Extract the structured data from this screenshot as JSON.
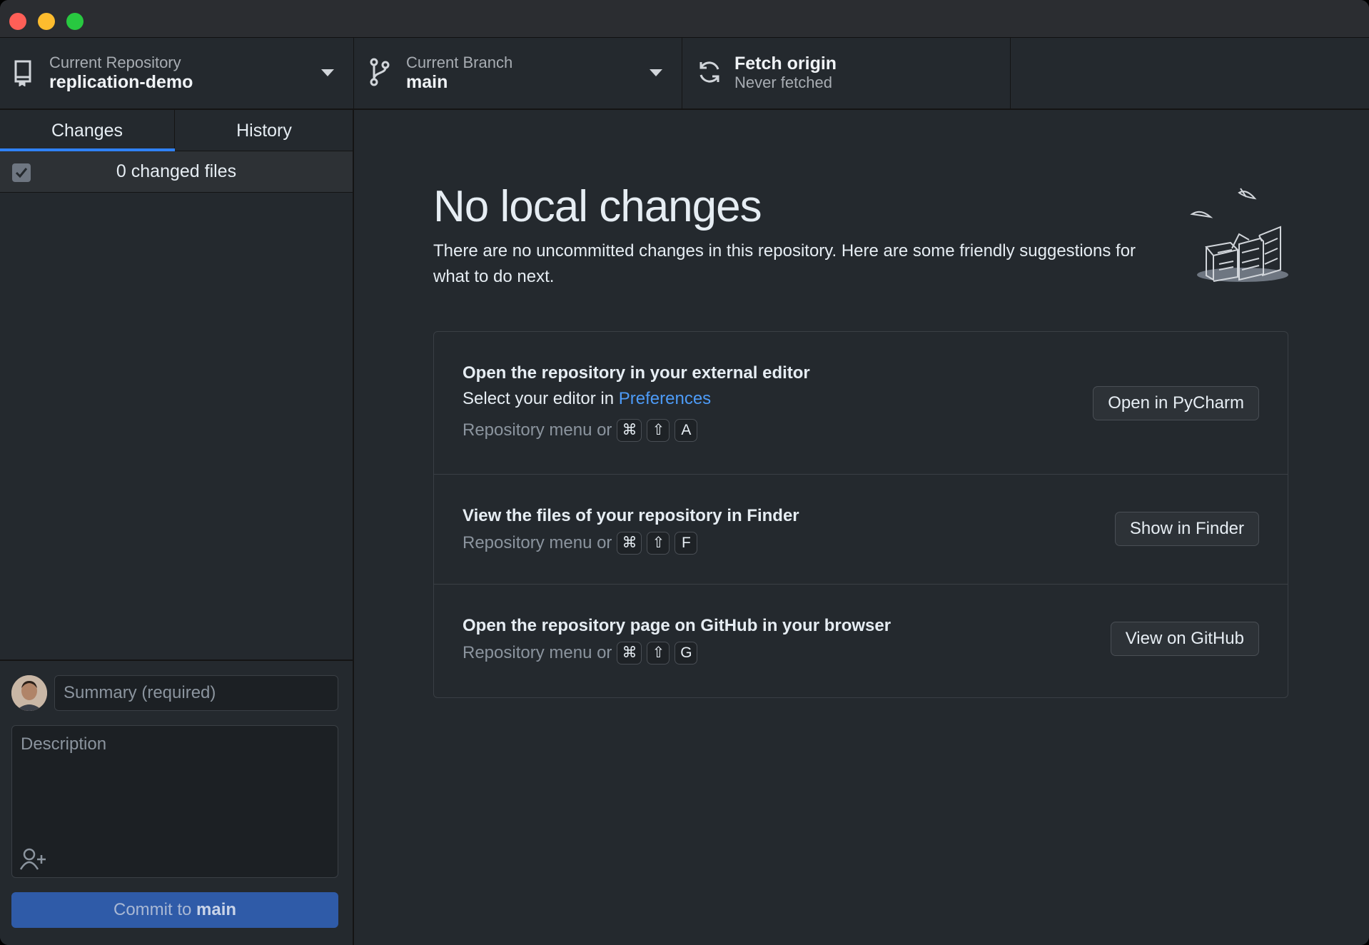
{
  "toolbar": {
    "repo_label": "Current Repository",
    "repo_value": "replication-demo",
    "branch_label": "Current Branch",
    "branch_value": "main",
    "fetch_label": "Fetch origin",
    "fetch_sub": "Never fetched"
  },
  "sidebar": {
    "tabs": [
      {
        "label": "Changes",
        "active": true
      },
      {
        "label": "History",
        "active": false
      }
    ],
    "changed_files": "0 changed files",
    "summary_placeholder": "Summary (required)",
    "description_placeholder": "Description",
    "commit_prefix": "Commit to ",
    "commit_branch": "main"
  },
  "main": {
    "heading": "No local changes",
    "subheading": "There are no uncommitted changes in this repository. Here are some friendly suggestions for what to do next.",
    "cards": [
      {
        "title": "Open the repository in your external editor",
        "line_prefix": "Select your editor in ",
        "line_link": "Preferences",
        "hint": "Repository menu or",
        "keys": [
          "⌘",
          "⇧",
          "A"
        ],
        "button": "Open in PyCharm"
      },
      {
        "title": "View the files of your repository in Finder",
        "hint": "Repository menu or",
        "keys": [
          "⌘",
          "⇧",
          "F"
        ],
        "button": "Show in Finder"
      },
      {
        "title": "Open the repository page on GitHub in your browser",
        "hint": "Repository menu or",
        "keys": [
          "⌘",
          "⇧",
          "G"
        ],
        "button": "View on GitHub"
      }
    ]
  },
  "colors": {
    "background": "#24292e",
    "accent": "#2f81f7",
    "commit_button": "#2f5ba8",
    "link": "#4d9bf7"
  }
}
